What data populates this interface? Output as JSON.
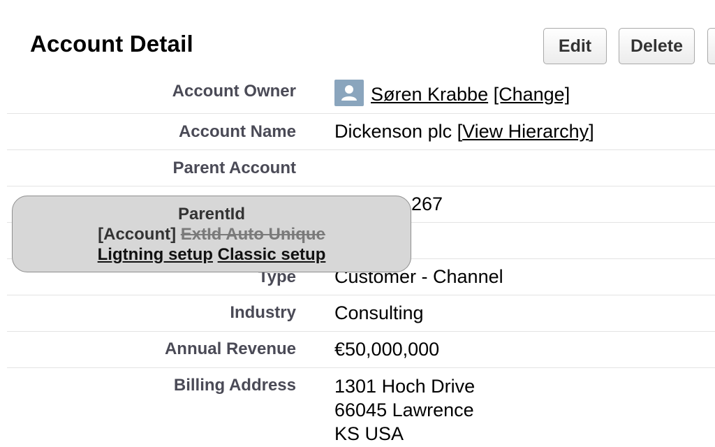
{
  "header": {
    "title": "Account Detail",
    "buttons": {
      "edit": "Edit",
      "delete": "Delete"
    }
  },
  "fields": {
    "owner": {
      "label": "Account Owner",
      "value": "Søren Krabbe",
      "change_link": "[Change]",
      "icon": "user-avatar-icon"
    },
    "name": {
      "label": "Account Name",
      "value": "Dickenson plc",
      "hierarchy_link_open": "[",
      "hierarchy_link": "View Hierarchy",
      "hierarchy_link_close": "]"
    },
    "parent": {
      "label": "Parent Account",
      "value": ""
    },
    "number": {
      "value_partial": "267"
    },
    "type": {
      "label": "Type",
      "value": "Customer - Channel"
    },
    "industry": {
      "label": "Industry",
      "value": "Consulting"
    },
    "revenue": {
      "label": "Annual Revenue",
      "value": "€50,000,000"
    },
    "billing": {
      "label": "Billing Address",
      "line1": "1301 Hoch Drive",
      "line2": "66045 Lawrence",
      "line3": "KS USA"
    }
  },
  "tooltip": {
    "title": "ParentId",
    "object": "[Account]",
    "struck": "ExtId Auto Unique",
    "lightning_link": "Ligtning setup",
    "classic_link": "Classic setup"
  },
  "colors": {
    "label": "#4a4a56",
    "avatar": "#8aa5bd",
    "tooltip_bg": "#d7d7d7"
  }
}
